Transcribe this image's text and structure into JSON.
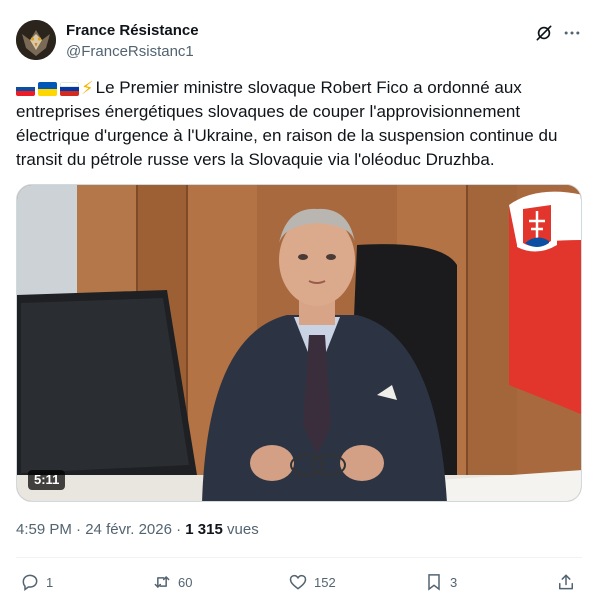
{
  "post": {
    "author_name": "France Résistance",
    "author_handle": "@FranceRsistanc1",
    "flag_emojis": [
      "slovakia-flag",
      "ukraine-flag",
      "russia-flag"
    ],
    "bolt_emoji": "⚡",
    "text": "Le Premier ministre slovaque Robert Fico a ordonné aux entreprises énergétiques slovaques de couper l'approvisionnement électrique d'urgence à l'Ukraine, en raison de la suspension continue du transit du pétrole russe vers la Slovaquie via l'oléoduc Druzhba.",
    "video_duration": "5:11",
    "time": "4:59 PM",
    "date": "24 févr. 2026",
    "views_count": "1 315",
    "views_label": "vues"
  },
  "actions": {
    "replies": "1",
    "reposts": "60",
    "likes": "152",
    "bookmarks": "3"
  },
  "icons": {
    "grok": "grok-icon",
    "more": "more-icon",
    "reply": "reply-icon",
    "repost": "repost-icon",
    "like": "like-icon",
    "bookmark": "bookmark-icon",
    "share": "share-icon"
  },
  "colors": {
    "text_primary": "#0f1419",
    "text_secondary": "#536471",
    "border": "#cfd9de"
  }
}
